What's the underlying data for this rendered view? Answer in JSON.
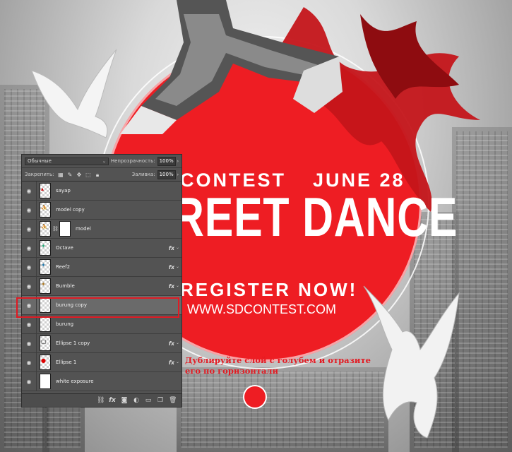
{
  "poster": {
    "contest": "CONTEST",
    "date": "JUNE 28",
    "title": "REET DANCE",
    "register": "REGISTER NOW!",
    "website": "WWW.SDCONTEST.COM"
  },
  "hint": {
    "line1": "Дублируйте слой с голубем и отразите",
    "line2": "его по горизонтали"
  },
  "layers_panel": {
    "blend_mode": "Обычные",
    "opacity_label": "Непрозрачность:",
    "opacity_value": "100%",
    "lock_label": "Закрепить:",
    "fill_label": "Заливка:",
    "fill_value": "100%",
    "layers": [
      {
        "name": "sayap",
        "fx": false,
        "selected": false
      },
      {
        "name": "model copy",
        "fx": false,
        "selected": false
      },
      {
        "name": "model",
        "fx": false,
        "selected": false,
        "mask": true
      },
      {
        "name": "Octave",
        "fx": true,
        "selected": false
      },
      {
        "name": "Reef2",
        "fx": true,
        "selected": false
      },
      {
        "name": "Bumble",
        "fx": true,
        "selected": false
      },
      {
        "name": "burung copy",
        "fx": false,
        "selected": true
      },
      {
        "name": "burung",
        "fx": false,
        "selected": false
      },
      {
        "name": "Ellipse 1 copy",
        "fx": true,
        "selected": false
      },
      {
        "name": "Ellipse 1",
        "fx": true,
        "selected": false
      },
      {
        "name": "white exposure",
        "fx": false,
        "selected": false
      }
    ],
    "fx_label": "fx"
  },
  "colors": {
    "accent_red": "#ee1d23",
    "panel_bg": "#535353"
  }
}
